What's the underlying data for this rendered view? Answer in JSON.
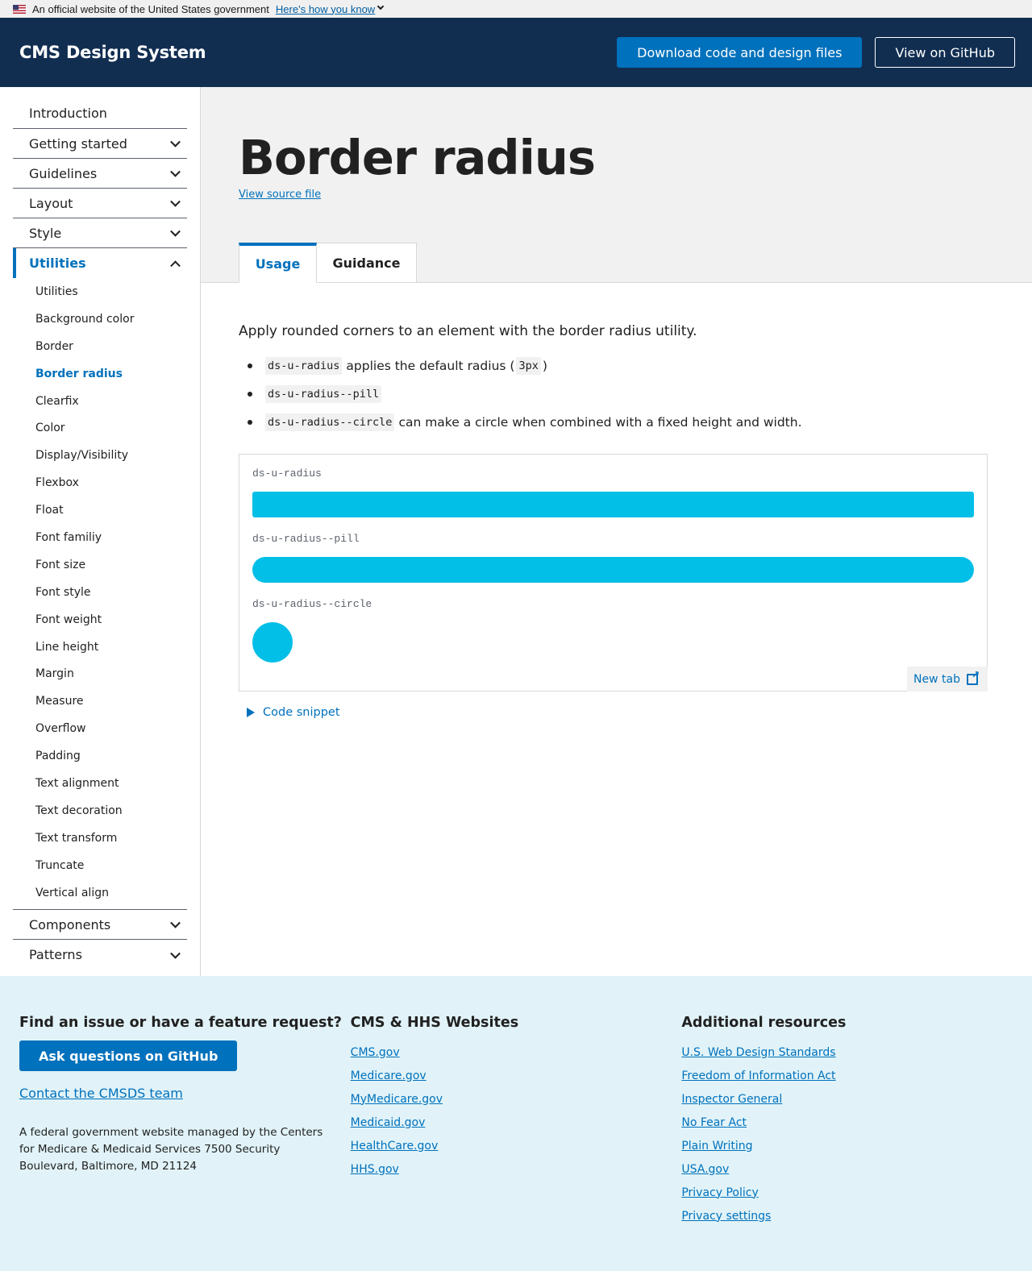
{
  "gov_banner": {
    "text": "An official website of the United States government",
    "link": "Here’s how you know"
  },
  "header": {
    "title": "CMS Design System",
    "download_label": "Download code and design files",
    "github_label": "View on GitHub"
  },
  "sidebar": {
    "items": [
      {
        "label": "Introduction"
      },
      {
        "label": "Getting started"
      },
      {
        "label": "Guidelines"
      },
      {
        "label": "Layout"
      },
      {
        "label": "Style"
      },
      {
        "label": "Utilities"
      },
      {
        "label": "Components"
      },
      {
        "label": "Patterns"
      }
    ],
    "utilities_sub": [
      "Utilities",
      "Background color",
      "Border",
      "Border radius",
      "Clearfix",
      "Color",
      "Display/Visibility",
      "Flexbox",
      "Float",
      "Font familiy",
      "Font size",
      "Font style",
      "Font weight",
      "Line height",
      "Margin",
      "Measure",
      "Overflow",
      "Padding",
      "Text alignment",
      "Text decoration",
      "Text transform",
      "Truncate",
      "Vertical align"
    ]
  },
  "page": {
    "title": "Border radius",
    "source_link": "View source file",
    "tabs": [
      "Usage",
      "Guidance"
    ]
  },
  "content": {
    "lead": "Apply rounded corners to an element with the border radius utility.",
    "bullets": [
      {
        "code": "ds-u-radius",
        "text_a": "applies the default radius (",
        "code2": "3px",
        "text_b": ")"
      },
      {
        "code": "ds-u-radius--pill"
      },
      {
        "code": "ds-u-radius--circle",
        "text_a": "can make a circle when combined with a fixed height and width."
      }
    ],
    "demo": {
      "labels": [
        "ds-u-radius",
        "ds-u-radius--pill",
        "ds-u-radius--circle"
      ],
      "new_tab": "New tab"
    },
    "code_snippet": "Code snippet"
  },
  "footer": {
    "col1": {
      "heading": "Find an issue or have a feature request?",
      "button": "Ask questions on GitHub",
      "contact": "Contact the CMSDS team",
      "text": "A federal government website managed by the Centers for Medicare & Medicaid Services 7500 Security Boulevard, Baltimore, MD 21124"
    },
    "col2": {
      "heading": "CMS & HHS Websites",
      "links": [
        "CMS.gov",
        "Medicare.gov",
        "MyMedicare.gov",
        "Medicaid.gov",
        "HealthCare.gov",
        "HHS.gov"
      ]
    },
    "col3": {
      "heading": "Additional resources",
      "links": [
        "U.S. Web Design Standards",
        "Freedom of Information Act",
        "Inspector General",
        "No Fear Act",
        "Plain Writing",
        "USA.gov",
        "Privacy Policy",
        "Privacy settings"
      ]
    }
  },
  "colors": {
    "header_bg": "#112e51",
    "primary": "#0071bc",
    "demo_fill": "#02bfe7",
    "footer_bg": "#e1f3f8"
  }
}
